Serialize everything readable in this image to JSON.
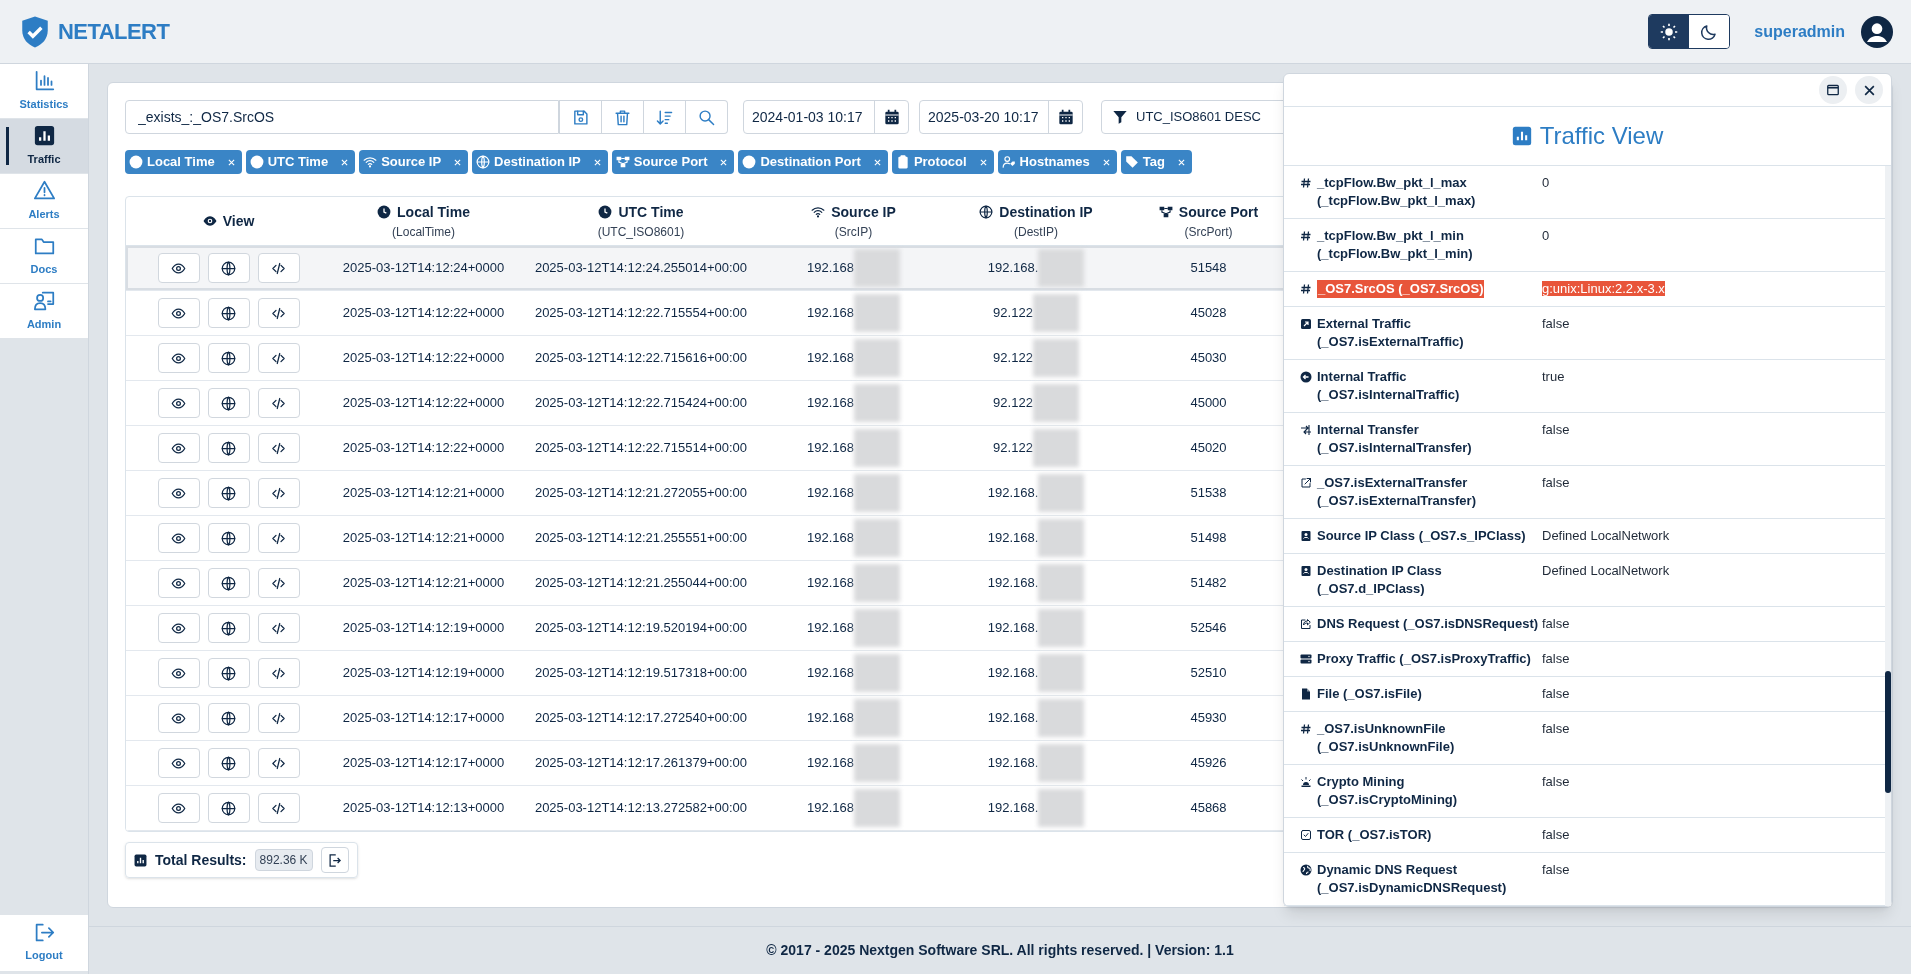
{
  "header": {
    "brand": "NETALERT",
    "theme": [
      {
        "kind": "light",
        "selected": true
      },
      {
        "kind": "dark",
        "selected": false
      }
    ],
    "user": "superadmin"
  },
  "sidebar": {
    "items": [
      {
        "label": "Statistics",
        "kind": "statistics",
        "selected": false
      },
      {
        "label": "Traffic",
        "kind": "traffic",
        "selected": true
      },
      {
        "label": "Alerts",
        "kind": "alerts",
        "selected": false
      },
      {
        "label": "Docs",
        "kind": "docs",
        "selected": false
      },
      {
        "label": "Admin",
        "kind": "admin",
        "selected": false
      }
    ],
    "logout": "Logout"
  },
  "toolbar": {
    "query": "_exists_:_OS7.SrcOS",
    "from": "2024-01-03 10:17",
    "to": "2025-03-20 10:17",
    "sort": "UTC_ISO8601 DESC"
  },
  "tags": [
    {
      "label": "Local Time",
      "kind": "time"
    },
    {
      "label": "UTC Time",
      "kind": "time"
    },
    {
      "label": "Source IP",
      "kind": "source_ip"
    },
    {
      "label": "Destination IP",
      "kind": "destination_ip"
    },
    {
      "label": "Source Port",
      "kind": "source_port"
    },
    {
      "label": "Destination Port",
      "kind": "destination_port"
    },
    {
      "label": "Protocol",
      "kind": "protocol"
    },
    {
      "label": "Hostnames",
      "kind": "hostnames"
    },
    {
      "label": "Tag",
      "kind": "tag"
    }
  ],
  "table": {
    "columns": [
      {
        "title": "View",
        "kind": "view"
      },
      {
        "title": "Local Time",
        "field": "(LocalTime)",
        "kind": "time"
      },
      {
        "title": "UTC Time",
        "field": "(UTC_ISO8601)",
        "kind": "time"
      },
      {
        "title": "Source IP",
        "field": "(SrcIP)",
        "kind": "source_ip"
      },
      {
        "title": "Destination IP",
        "field": "(DestIP)",
        "kind": "destination_ip"
      },
      {
        "title": "Source Port",
        "field": "(SrcPort)",
        "kind": "source_port"
      }
    ],
    "rows": [
      {
        "selected": true,
        "local": "2025-03-12T14:12:24+0000",
        "utc": "2025-03-12T14:12:24.255014+00:00",
        "src": "192.168",
        "dst": "192.168.",
        "port": "51548"
      },
      {
        "selected": false,
        "local": "2025-03-12T14:12:22+0000",
        "utc": "2025-03-12T14:12:22.715554+00:00",
        "src": "192.168",
        "dst": "92.122",
        "port": "45028"
      },
      {
        "selected": false,
        "local": "2025-03-12T14:12:22+0000",
        "utc": "2025-03-12T14:12:22.715616+00:00",
        "src": "192.168",
        "dst": "92.122",
        "port": "45030"
      },
      {
        "selected": false,
        "local": "2025-03-12T14:12:22+0000",
        "utc": "2025-03-12T14:12:22.715424+00:00",
        "src": "192.168",
        "dst": "92.122",
        "port": "45000"
      },
      {
        "selected": false,
        "local": "2025-03-12T14:12:22+0000",
        "utc": "2025-03-12T14:12:22.715514+00:00",
        "src": "192.168",
        "dst": "92.122",
        "port": "45020"
      },
      {
        "selected": false,
        "local": "2025-03-12T14:12:21+0000",
        "utc": "2025-03-12T14:12:21.272055+00:00",
        "src": "192.168",
        "dst": "192.168.",
        "port": "51538"
      },
      {
        "selected": false,
        "local": "2025-03-12T14:12:21+0000",
        "utc": "2025-03-12T14:12:21.255551+00:00",
        "src": "192.168",
        "dst": "192.168.",
        "port": "51498"
      },
      {
        "selected": false,
        "local": "2025-03-12T14:12:21+0000",
        "utc": "2025-03-12T14:12:21.255044+00:00",
        "src": "192.168",
        "dst": "192.168.",
        "port": "51482"
      },
      {
        "selected": false,
        "local": "2025-03-12T14:12:19+0000",
        "utc": "2025-03-12T14:12:19.520194+00:00",
        "src": "192.168",
        "dst": "192.168.",
        "port": "52546"
      },
      {
        "selected": false,
        "local": "2025-03-12T14:12:19+0000",
        "utc": "2025-03-12T14:12:19.517318+00:00",
        "src": "192.168",
        "dst": "192.168.",
        "port": "52510"
      },
      {
        "selected": false,
        "local": "2025-03-12T14:12:17+0000",
        "utc": "2025-03-12T14:12:17.272540+00:00",
        "src": "192.168",
        "dst": "192.168.",
        "port": "45930"
      },
      {
        "selected": false,
        "local": "2025-03-12T14:12:17+0000",
        "utc": "2025-03-12T14:12:17.261379+00:00",
        "src": "192.168",
        "dst": "192.168.",
        "port": "45926"
      },
      {
        "selected": false,
        "local": "2025-03-12T14:12:13+0000",
        "utc": "2025-03-12T14:12:13.272582+00:00",
        "src": "192.168",
        "dst": "192.168.",
        "port": "45868"
      }
    ]
  },
  "results": {
    "label": "Total Results:",
    "count": "892.36 K"
  },
  "modal": {
    "title": "Traffic View",
    "fields": [
      {
        "kind": "number",
        "label": "_tcpFlow.Bw_pkt_l_max (_tcpFlow.Bw_pkt_l_max)",
        "value": "0",
        "highlighted": false
      },
      {
        "kind": "number",
        "label": "_tcpFlow.Bw_pkt_l_min (_tcpFlow.Bw_pkt_l_min)",
        "value": "0",
        "highlighted": false
      },
      {
        "kind": "number",
        "label": "_OS7.SrcOS (_OS7.SrcOS)",
        "value": "g:unix:Linux:2.2.x-3.x",
        "highlighted": true
      },
      {
        "kind": "external_traffic",
        "label": "External Traffic (_OS7.isExternalTraffic)",
        "value": "false",
        "highlighted": false
      },
      {
        "kind": "internal_traffic",
        "label": "Internal Traffic (_OS7.isInternalTraffic)",
        "value": "true",
        "highlighted": false
      },
      {
        "kind": "internal_transfer",
        "label": "Internal Transfer (_OS7.isInternalTransfer)",
        "value": "false",
        "highlighted": false
      },
      {
        "kind": "external_transfer",
        "label": "_OS7.isExternalTransfer (_OS7.isExternalTransfer)",
        "value": "false",
        "highlighted": false
      },
      {
        "kind": "ip_class",
        "label": "Source IP Class (_OS7.s_IPClass)",
        "value": "Defined LocalNetwork",
        "highlighted": false
      },
      {
        "kind": "ip_class",
        "label": "Destination IP Class (_OS7.d_IPClass)",
        "value": "Defined LocalNetwork",
        "highlighted": false
      },
      {
        "kind": "dns",
        "label": "DNS Request (_OS7.isDNSRequest)",
        "value": "false",
        "highlighted": false
      },
      {
        "kind": "proxy",
        "label": "Proxy Traffic (_OS7.isProxyTraffic)",
        "value": "false",
        "highlighted": false
      },
      {
        "kind": "file",
        "label": "File (_OS7.isFile)",
        "value": "false",
        "highlighted": false
      },
      {
        "kind": "number",
        "label": "_OS7.isUnknownFile (_OS7.isUnknownFile)",
        "value": "false",
        "highlighted": false
      },
      {
        "kind": "mining",
        "label": "Crypto Mining (_OS7.isCryptoMining)",
        "value": "false",
        "highlighted": false
      },
      {
        "kind": "tor",
        "label": "TOR (_OS7.isTOR)",
        "value": "false",
        "highlighted": false
      },
      {
        "kind": "dynamic_dns",
        "label": "Dynamic DNS Request (_OS7.isDynamicDNSRequest)",
        "value": "false",
        "highlighted": false
      }
    ]
  },
  "footer": "© 2017 - 2025 Nextgen Software SRL. All rights reserved. | Version: 1.1"
}
